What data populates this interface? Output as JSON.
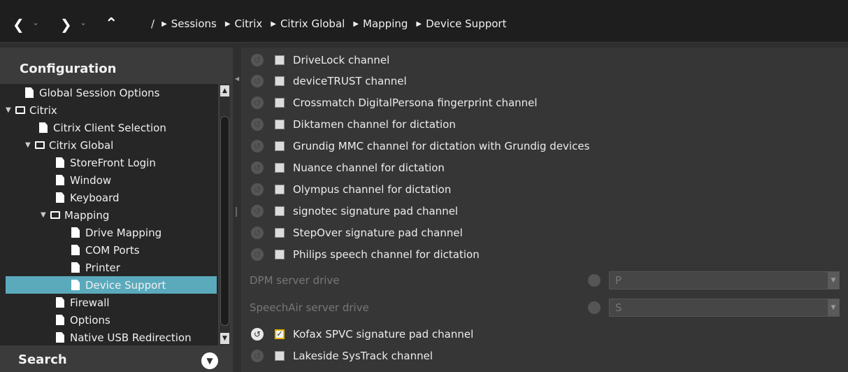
{
  "nav": {
    "back_icon": "chevron-left-icon",
    "forward_icon": "chevron-right-icon",
    "up_icon": "chevron-up-icon",
    "dropdown_glyph": "⌄"
  },
  "breadcrumbs": [
    "/",
    "Sessions",
    "Citrix",
    "Citrix Global",
    "Mapping",
    "Device Support"
  ],
  "sidebar": {
    "title": "Configuration",
    "search_label": "Search",
    "items": [
      {
        "label": "Global Session Options",
        "type": "doc",
        "level": 0,
        "expanded": false
      },
      {
        "label": "Citrix",
        "type": "folder",
        "level": 0,
        "expanded": true
      },
      {
        "label": "Citrix Client Selection",
        "type": "doc",
        "level": 1,
        "expanded": false
      },
      {
        "label": "Citrix Global",
        "type": "folder",
        "level": 1,
        "expanded": true
      },
      {
        "label": "StoreFront Login",
        "type": "doc",
        "level": 2,
        "expanded": false
      },
      {
        "label": "Window",
        "type": "doc",
        "level": 2,
        "expanded": false
      },
      {
        "label": "Keyboard",
        "type": "doc",
        "level": 2,
        "expanded": false
      },
      {
        "label": "Mapping",
        "type": "folder",
        "level": 2,
        "expanded": true
      },
      {
        "label": "Drive Mapping",
        "type": "doc",
        "level": 3,
        "expanded": false
      },
      {
        "label": "COM Ports",
        "type": "doc",
        "level": 3,
        "expanded": false
      },
      {
        "label": "Printer",
        "type": "doc",
        "level": 3,
        "expanded": false
      },
      {
        "label": "Device Support",
        "type": "doc",
        "level": 3,
        "expanded": false,
        "selected": true
      },
      {
        "label": "Firewall",
        "type": "doc",
        "level": 2,
        "expanded": false
      },
      {
        "label": "Options",
        "type": "doc",
        "level": 2,
        "expanded": false
      },
      {
        "label": "Native USB Redirection",
        "type": "doc",
        "level": 2,
        "expanded": false
      }
    ]
  },
  "options": [
    {
      "label": "DriveLock channel",
      "checked": false
    },
    {
      "label": "deviceTRUST channel",
      "checked": false
    },
    {
      "label": "Crossmatch DigitalPersona fingerprint channel",
      "checked": false
    },
    {
      "label": "Diktamen channel for dictation",
      "checked": false
    },
    {
      "label": "Grundig MMC channel for dictation with Grundig devices",
      "checked": false
    },
    {
      "label": "Nuance channel for dictation",
      "checked": false
    },
    {
      "label": "Olympus channel for dictation",
      "checked": false
    },
    {
      "label": "signotec signature pad channel",
      "checked": false
    },
    {
      "label": "StepOver signature pad channel",
      "checked": false
    },
    {
      "label": "Philips speech channel for dictation",
      "checked": false
    }
  ],
  "fields": {
    "dpm": {
      "label": "DPM server drive",
      "value": "P"
    },
    "speechair": {
      "label": "SpeechAir server drive",
      "value": "S"
    }
  },
  "options_bottom": [
    {
      "label": "Kofax SPVC signature pad channel",
      "checked": true
    },
    {
      "label": "Lakeside SysTrack channel",
      "checked": false
    }
  ],
  "colors": {
    "selection": "#5aaabc",
    "checkbox_highlight": "#e8b400"
  }
}
